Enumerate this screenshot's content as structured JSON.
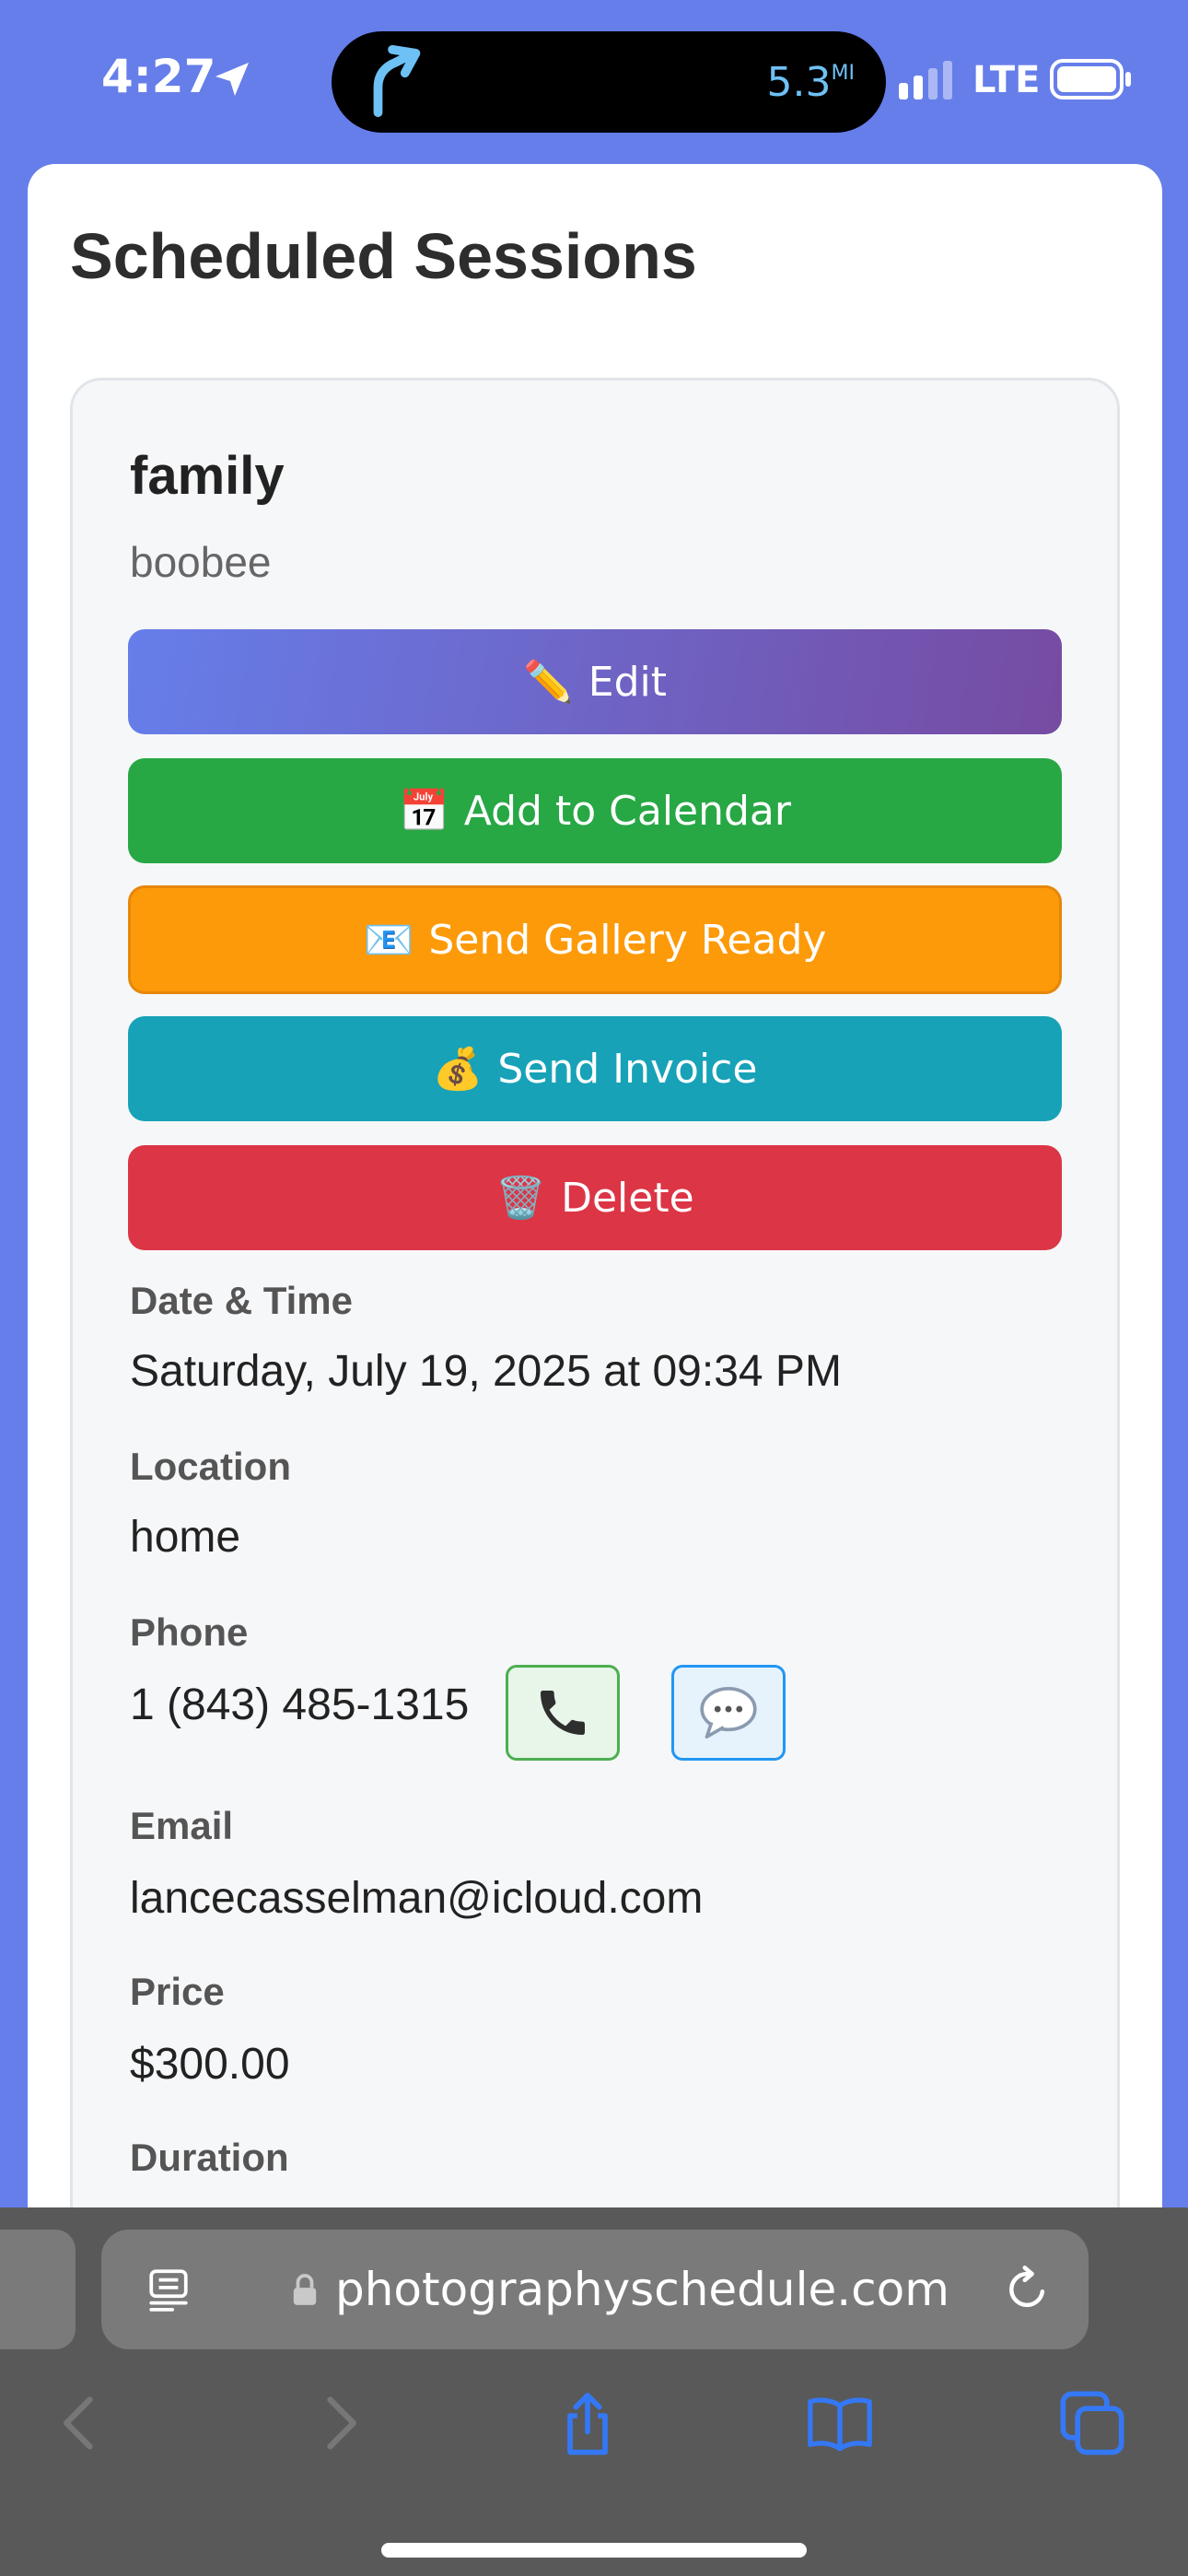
{
  "status_bar": {
    "time": "4:27",
    "distance": "5.3",
    "distance_unit": "MI",
    "network": "LTE"
  },
  "page": {
    "title": "Scheduled Sessions"
  },
  "session": {
    "type": "family",
    "client": "boobee",
    "buttons": {
      "edit": {
        "emoji": "✏️",
        "label": "Edit"
      },
      "calendar": {
        "emoji": "📅",
        "label": "Add to Calendar"
      },
      "gallery": {
        "emoji": "📧",
        "label": "Send Gallery Ready"
      },
      "invoice": {
        "emoji": "💰",
        "label": "Send Invoice"
      },
      "delete": {
        "emoji": "🗑️",
        "label": "Delete"
      }
    },
    "date_label": "Date & Time",
    "date_value": "Saturday, July 19, 2025 at 09:34 PM",
    "location_label": "Location",
    "location_value": "home",
    "phone_label": "Phone",
    "phone_value": "1 (843) 485-1315",
    "email_label": "Email",
    "email_value": "lancecasselman@icloud.com",
    "price_label": "Price",
    "price_value": "$300.00",
    "duration_label": "Duration"
  },
  "browser": {
    "url": "photographyschedule.com"
  },
  "colors": {
    "header_bg": "#667eea",
    "edit_gradient_start": "#667eea",
    "edit_gradient_end": "#764ba2",
    "calendar": "#28a745",
    "gallery": "#fd9a0a",
    "invoice": "#17a2b8",
    "delete": "#dc3545",
    "ios_blue": "#3478f6"
  },
  "icons": {
    "status_location": "location-arrow-icon",
    "navigation": "turn-arrow-icon",
    "call": "phone-icon",
    "message": "speech-bubble-icon",
    "reader": "reader-mode-icon",
    "lock": "lock-icon",
    "reload": "reload-icon",
    "back": "back-chevron-icon",
    "forward": "forward-chevron-icon",
    "share": "share-icon",
    "bookmarks": "book-icon",
    "tabs": "tabs-icon"
  }
}
